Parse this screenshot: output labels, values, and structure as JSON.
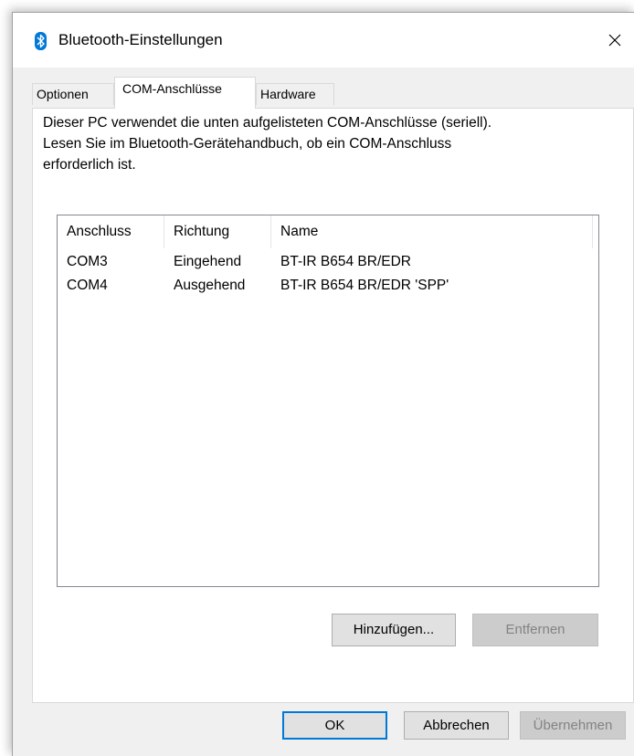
{
  "window": {
    "title": "Bluetooth-Einstellungen",
    "icon": "bluetooth-icon",
    "close_icon": "close-icon"
  },
  "tabs": [
    {
      "label": "Optionen",
      "active": false
    },
    {
      "label": "COM-Anschlüsse",
      "active": true
    },
    {
      "label": "Hardware",
      "active": false
    }
  ],
  "description": {
    "line1": "Dieser PC verwendet die unten aufgelisteten COM-Anschlüsse (seriell).",
    "line2": "Lesen Sie im Bluetooth-Gerätehandbuch, ob ein COM-Anschluss",
    "line3": "erforderlich ist."
  },
  "ports_list": {
    "columns": [
      "Anschluss",
      "Richtung",
      "Name"
    ],
    "rows": [
      {
        "port": "COM3",
        "direction": "Eingehend",
        "name": "BT-IR B654 BR/EDR"
      },
      {
        "port": "COM4",
        "direction": "Ausgehend",
        "name": "BT-IR B654 BR/EDR 'SPP'"
      }
    ]
  },
  "list_buttons": {
    "add_label": "Hinzufügen...",
    "remove_label": "Entfernen",
    "remove_enabled": false
  },
  "dialog_buttons": {
    "ok_label": "OK",
    "cancel_label": "Abbrechen",
    "apply_label": "Übernehmen",
    "apply_enabled": false
  },
  "colors": {
    "bluetooth_blue": "#0078d7",
    "dialog_bg": "#f0f0f0",
    "panel_bg": "#ffffff"
  }
}
